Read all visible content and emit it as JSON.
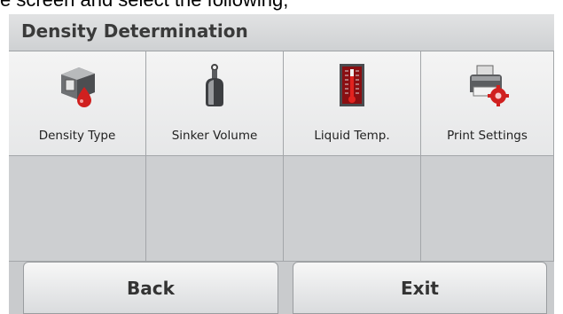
{
  "doc_text": "e screen and select the following;",
  "screen": {
    "title": "Density Determination",
    "menu_items": [
      {
        "label": "Density Type",
        "icon": "density-cube-icon"
      },
      {
        "label": "Sinker Volume",
        "icon": "sinker-icon"
      },
      {
        "label": "Liquid Temp.",
        "icon": "thermometer-icon"
      },
      {
        "label": "Print Settings",
        "icon": "printer-settings-icon"
      }
    ],
    "buttons": {
      "back": "Back",
      "exit": "Exit"
    }
  },
  "colors": {
    "title_bar": "#d8d9da",
    "tile_top": "#f0f0f0",
    "tile_empty": "#cdcfd1",
    "accent_red": "#d0201f"
  }
}
